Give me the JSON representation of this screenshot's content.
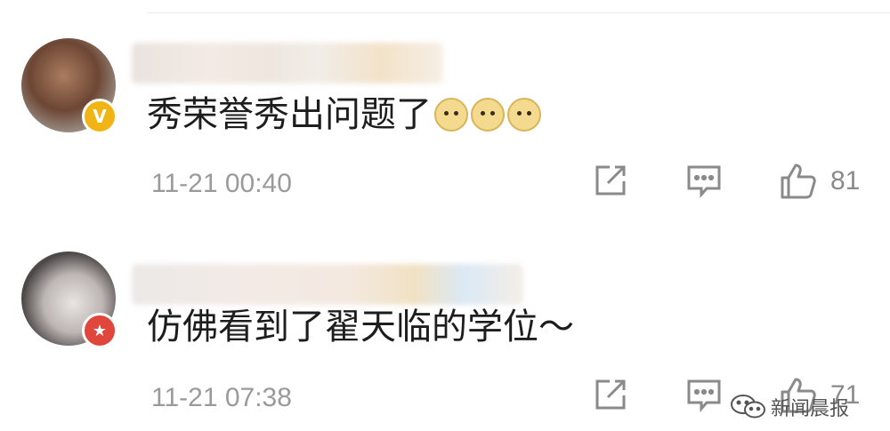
{
  "comments": [
    {
      "text": "秀荣誉秀出问题了",
      "emoji_count": 3,
      "emoji_icon": "doge-emoji-icon",
      "time": "11-21 00:40",
      "like_count": "81",
      "badge_icon": "verified-v-icon",
      "badge_glyph": "V",
      "badge_color": "#f0b414"
    },
    {
      "text": "仿佛看到了翟天临的学位～",
      "time": "11-21 07:38",
      "like_count": "71",
      "badge_icon": "star-badge-icon",
      "badge_glyph": "★",
      "badge_color": "#e0463b"
    }
  ],
  "watermark": {
    "text": "新闻晨报",
    "icon": "wechat-icon"
  }
}
